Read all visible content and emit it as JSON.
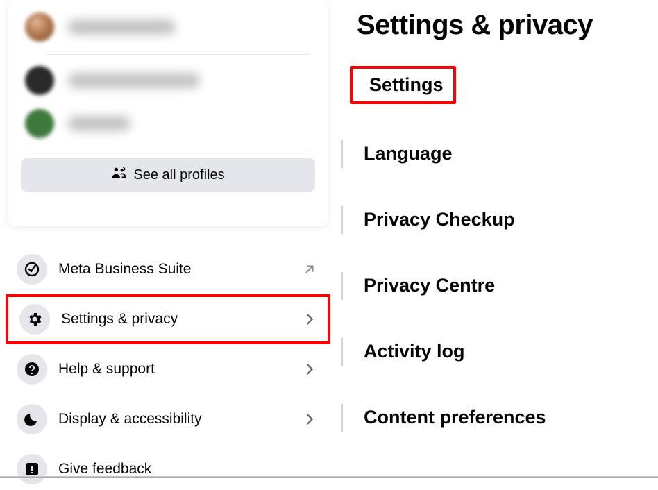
{
  "leftPane": {
    "seeAllProfiles": "See all profiles",
    "menu": {
      "metaBusiness": "Meta Business Suite",
      "settingsPrivacy": "Settings & privacy",
      "helpSupport": "Help & support",
      "displayAccessibility": "Display & accessibility",
      "giveFeedback": "Give feedback"
    }
  },
  "rightPane": {
    "title": "Settings & privacy",
    "items": {
      "settings": "Settings",
      "language": "Language",
      "privacyCheckup": "Privacy Checkup",
      "privacyCentre": "Privacy Centre",
      "activityLog": "Activity log",
      "contentPreferences": "Content preferences"
    }
  }
}
